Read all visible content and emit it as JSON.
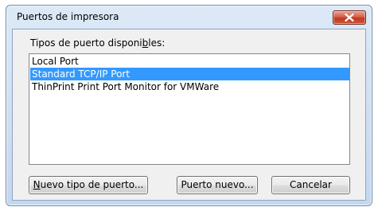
{
  "window": {
    "title": "Puertos de impresora",
    "close_icon": "close-x-icon",
    "colors": {
      "frame": "#c4d7ee",
      "close_button": "#c7432a",
      "selection": "#3399ff"
    }
  },
  "port_types": {
    "label_pre": "Tipos de puerto disponi",
    "label_accel": "b",
    "label_post": "les:",
    "items": [
      {
        "label": "Local Port",
        "selected": false
      },
      {
        "label": "Standard TCP/IP Port",
        "selected": true
      },
      {
        "label": "ThinPrint Print Port Monitor for VMWare",
        "selected": false
      }
    ]
  },
  "buttons": {
    "new_port_type": {
      "accel": "N",
      "rest": "uevo tipo de puerto..."
    },
    "new_port": {
      "label": "Puerto nuevo..."
    },
    "cancel": {
      "label": "Cancelar"
    }
  }
}
